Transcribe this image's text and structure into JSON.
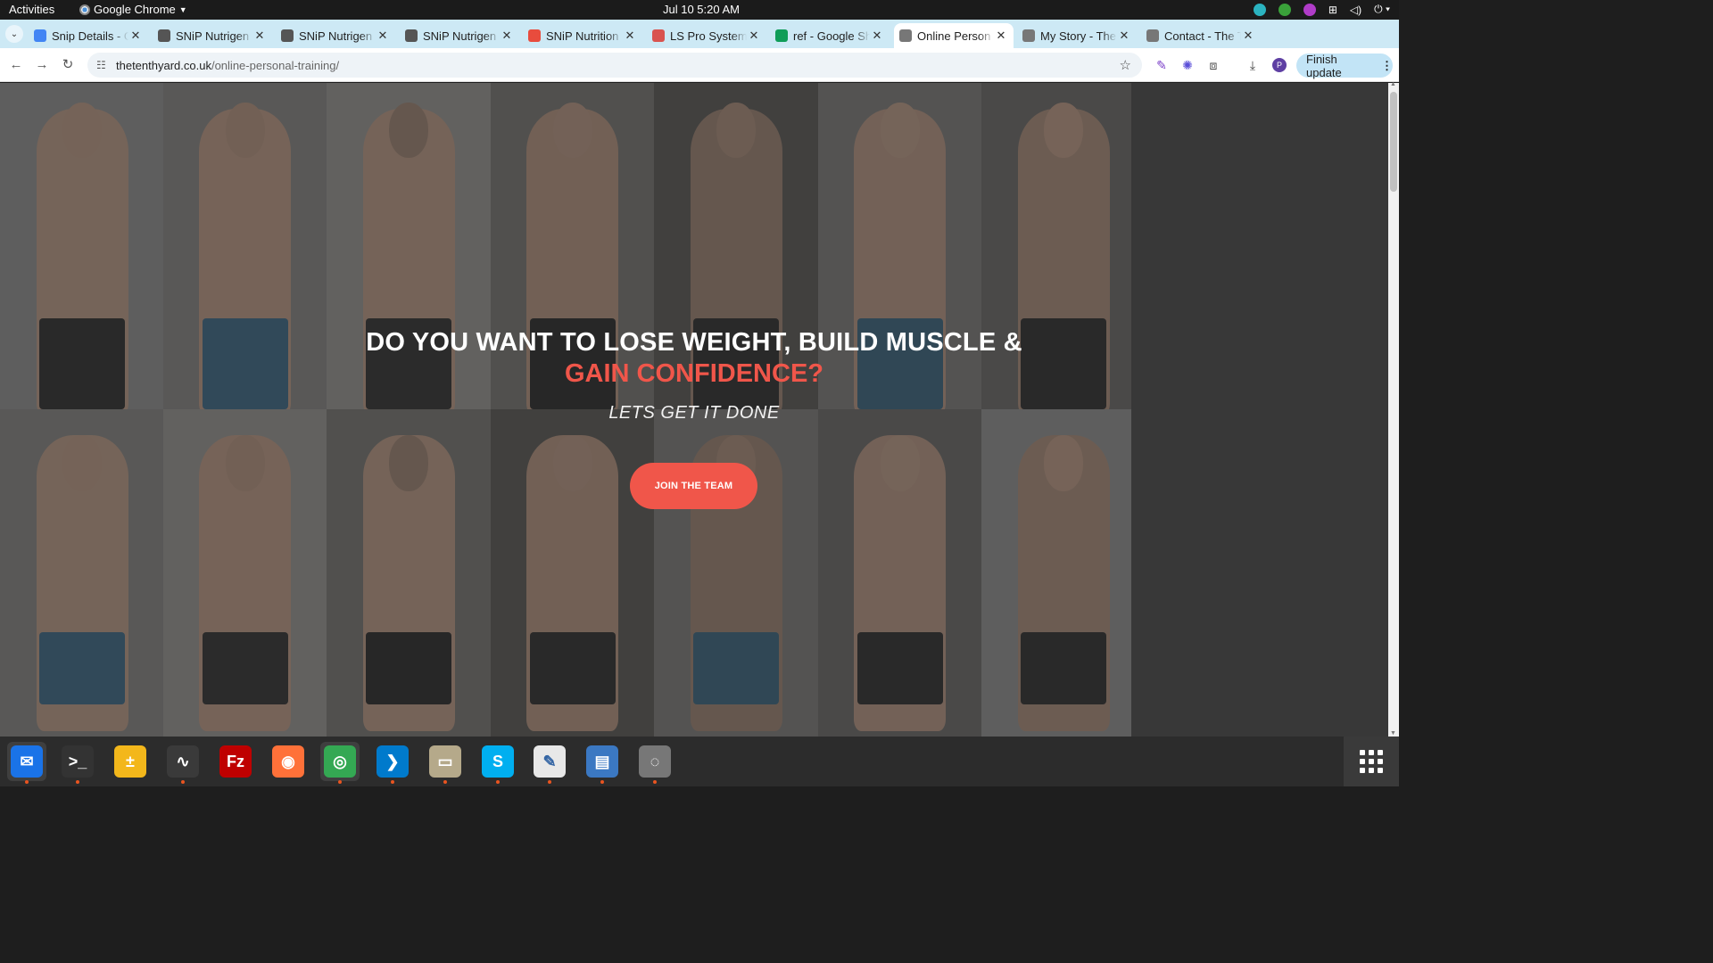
{
  "topbar": {
    "activities": "Activities",
    "app_name": "Google Chrome",
    "clock": "Jul 10  5:20 AM"
  },
  "tabs": [
    {
      "title": "Snip Details - G",
      "favicon": "docs-icon",
      "color": "#4285f4"
    },
    {
      "title": "SNiP Nutrigen",
      "favicon": "snip-icon",
      "color": "#555555"
    },
    {
      "title": "SNiP Nutrigen",
      "favicon": "snip-icon",
      "color": "#555555"
    },
    {
      "title": "SNiP Nutrigen",
      "favicon": "snip-icon",
      "color": "#555555"
    },
    {
      "title": "SNiP Nutrition",
      "favicon": "smiley-icon",
      "color": "#e84c3d"
    },
    {
      "title": "LS Pro System",
      "favicon": "ls-icon",
      "color": "#d9534f"
    },
    {
      "title": "ref - Google Sh",
      "favicon": "sheets-icon",
      "color": "#0f9d58"
    },
    {
      "title": "Online Person",
      "favicon": "tenth-yard-icon",
      "color": "#777777",
      "active": true
    },
    {
      "title": "My Story - The",
      "favicon": "tenth-yard-icon",
      "color": "#777777"
    },
    {
      "title": "Contact - The T",
      "favicon": "tenth-yard-icon",
      "color": "#777777"
    }
  ],
  "toolbar": {
    "url_domain": "thetenthyard.co.uk",
    "url_path": "/online-personal-training/",
    "finish_update": "Finish update",
    "profile_initial": "P"
  },
  "hero": {
    "headline_line1": "DO YOU WANT TO LOSE WEIGHT, BUILD MUSCLE &",
    "headline_line2": "GAIN CONFIDENCE?",
    "subheadline": "LETS GET IT DONE",
    "cta_label": "JOIN THE TEAM"
  },
  "colors": {
    "accent": "#f0564a",
    "tabstrip": "#cde9f5",
    "topbar": "#1b1b1b",
    "dock": "#2c2c2c"
  },
  "dock": [
    {
      "name": "thunderbird-icon",
      "color": "#1a73e8",
      "glyph": "✉",
      "running": true,
      "active": true
    },
    {
      "name": "terminal-icon",
      "color": "#333333",
      "glyph": ">_",
      "running": true
    },
    {
      "name": "calculator-icon",
      "color": "#f3b71b",
      "glyph": "±",
      "running": false
    },
    {
      "name": "system-monitor-icon",
      "color": "#3a3a3a",
      "glyph": "∿",
      "running": true
    },
    {
      "name": "filezilla-icon",
      "color": "#bf0000",
      "glyph": "Fz",
      "running": false
    },
    {
      "name": "firefox-icon",
      "color": "#ff7139",
      "glyph": "◉",
      "running": false
    },
    {
      "name": "chrome-icon",
      "color": "#34a853",
      "glyph": "◎",
      "running": true,
      "active": true
    },
    {
      "name": "vscode-icon",
      "color": "#007acc",
      "glyph": "❯",
      "running": true
    },
    {
      "name": "files-icon",
      "color": "#b5a98a",
      "glyph": "▭",
      "running": true
    },
    {
      "name": "skype-icon",
      "color": "#00aff0",
      "glyph": "S",
      "running": true
    },
    {
      "name": "text-editor-icon",
      "color": "#e8e8e8",
      "glyph": "✎",
      "running": true
    },
    {
      "name": "document-viewer-icon",
      "color": "#3b78c2",
      "glyph": "▤",
      "running": true
    },
    {
      "name": "disk-icon",
      "color": "#777777",
      "glyph": "◌",
      "running": true
    }
  ]
}
